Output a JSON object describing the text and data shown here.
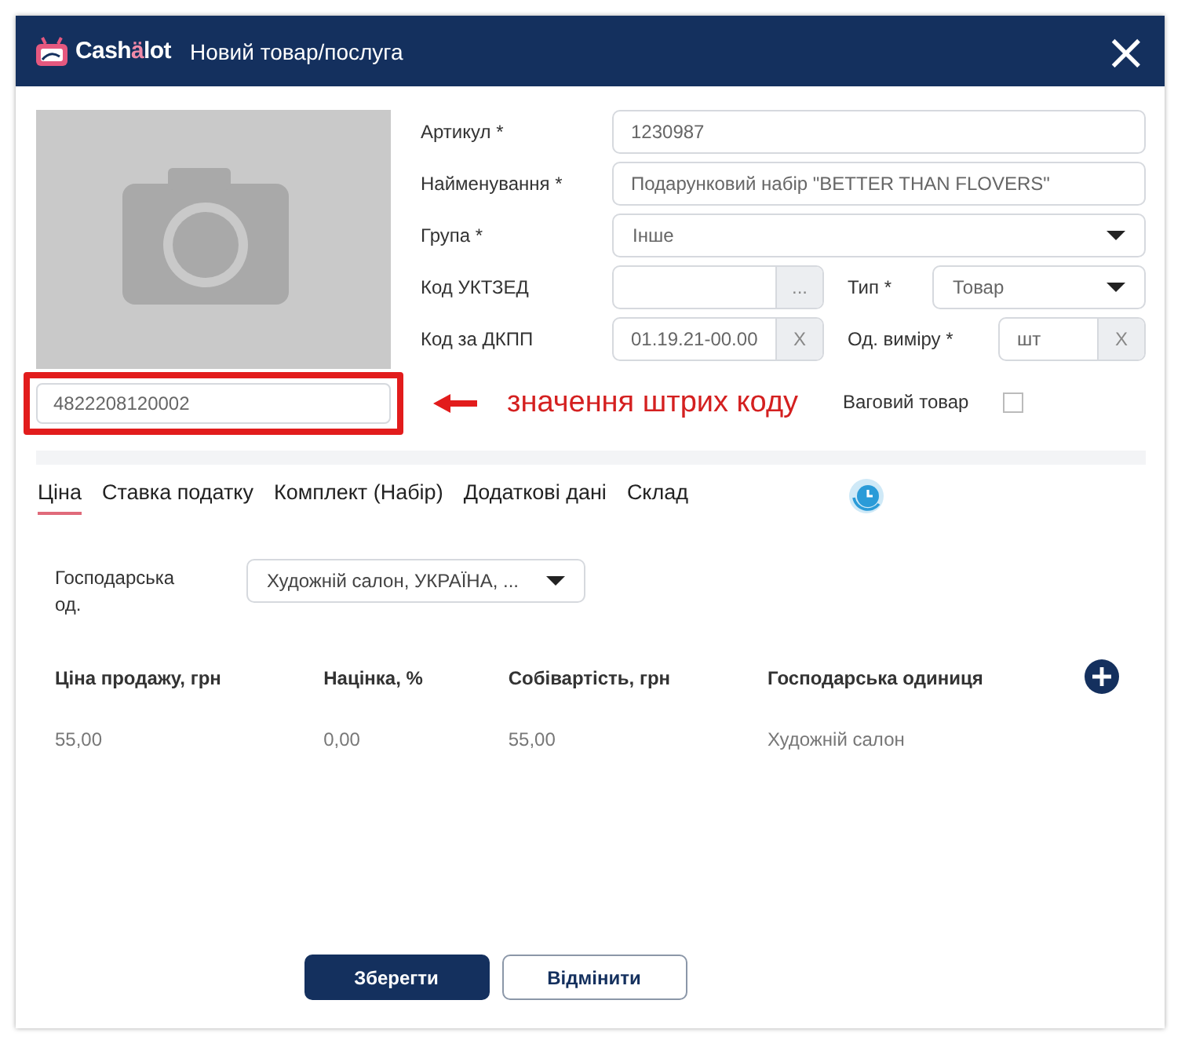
{
  "header": {
    "logo_parts": [
      {
        "kind": "plain",
        "text": "Cash"
      },
      {
        "kind": "accent",
        "text": "ä"
      },
      {
        "kind": "plain",
        "text": "lot"
      }
    ],
    "title": "Новий товар/послуга",
    "close": "×"
  },
  "barcode": {
    "value": "4822208120002",
    "highlighted": true
  },
  "annotation": {
    "text": "значення штрих коду"
  },
  "form": {
    "rows": [
      {
        "fields": [
          {
            "label": "Артикул *",
            "kind": "text",
            "value": "1230987"
          }
        ]
      },
      {
        "fields": [
          {
            "label": "Найменування *",
            "kind": "text",
            "value": "Подарунковий набір \"BETTER THAN FLOVERS\""
          }
        ]
      },
      {
        "fields": [
          {
            "label": "Група *",
            "kind": "select",
            "value": "Інше"
          }
        ]
      },
      {
        "fields": [
          {
            "label": "Код УКТЗЕД",
            "kind": "lookup",
            "button": "..."
          },
          {
            "label": "Тип *",
            "kind": "select",
            "value": "Товар"
          }
        ]
      },
      {
        "fields": [
          {
            "label": "Код за ДКПП",
            "kind": "lookup",
            "value": "01.19.21-00.00",
            "button": "X"
          },
          {
            "label": "Од. виміру *",
            "kind": "lookup",
            "value": "шт",
            "button": "X"
          }
        ]
      },
      {
        "fields": [
          {
            "label": "Ваговий товар",
            "kind": "checkbox",
            "checked": false
          }
        ]
      }
    ]
  },
  "tabs": [
    {
      "label": "Ціна",
      "selected": true
    },
    {
      "label": "Ставка податку",
      "selected": false
    },
    {
      "label": "Комплект (Набір)",
      "selected": false
    },
    {
      "label": "Додаткові дані",
      "selected": false
    },
    {
      "label": "Склад",
      "selected": false
    }
  ],
  "unit_filter": {
    "label": "Господарська од.",
    "value": "Художній салон, УКРАЇНА, ..."
  },
  "price_table": {
    "columns": [
      "Ціна продажу, грн",
      "Націнка, %",
      "Собівартість, грн",
      "Господарська одиниця"
    ],
    "rows": [
      [
        "55,00",
        "0,00",
        "55,00",
        "Художній салон"
      ]
    ]
  },
  "buttons": [
    {
      "label": "Зберегти",
      "kind": "primary"
    },
    {
      "label": "Відмінити",
      "kind": "secondary"
    }
  ]
}
